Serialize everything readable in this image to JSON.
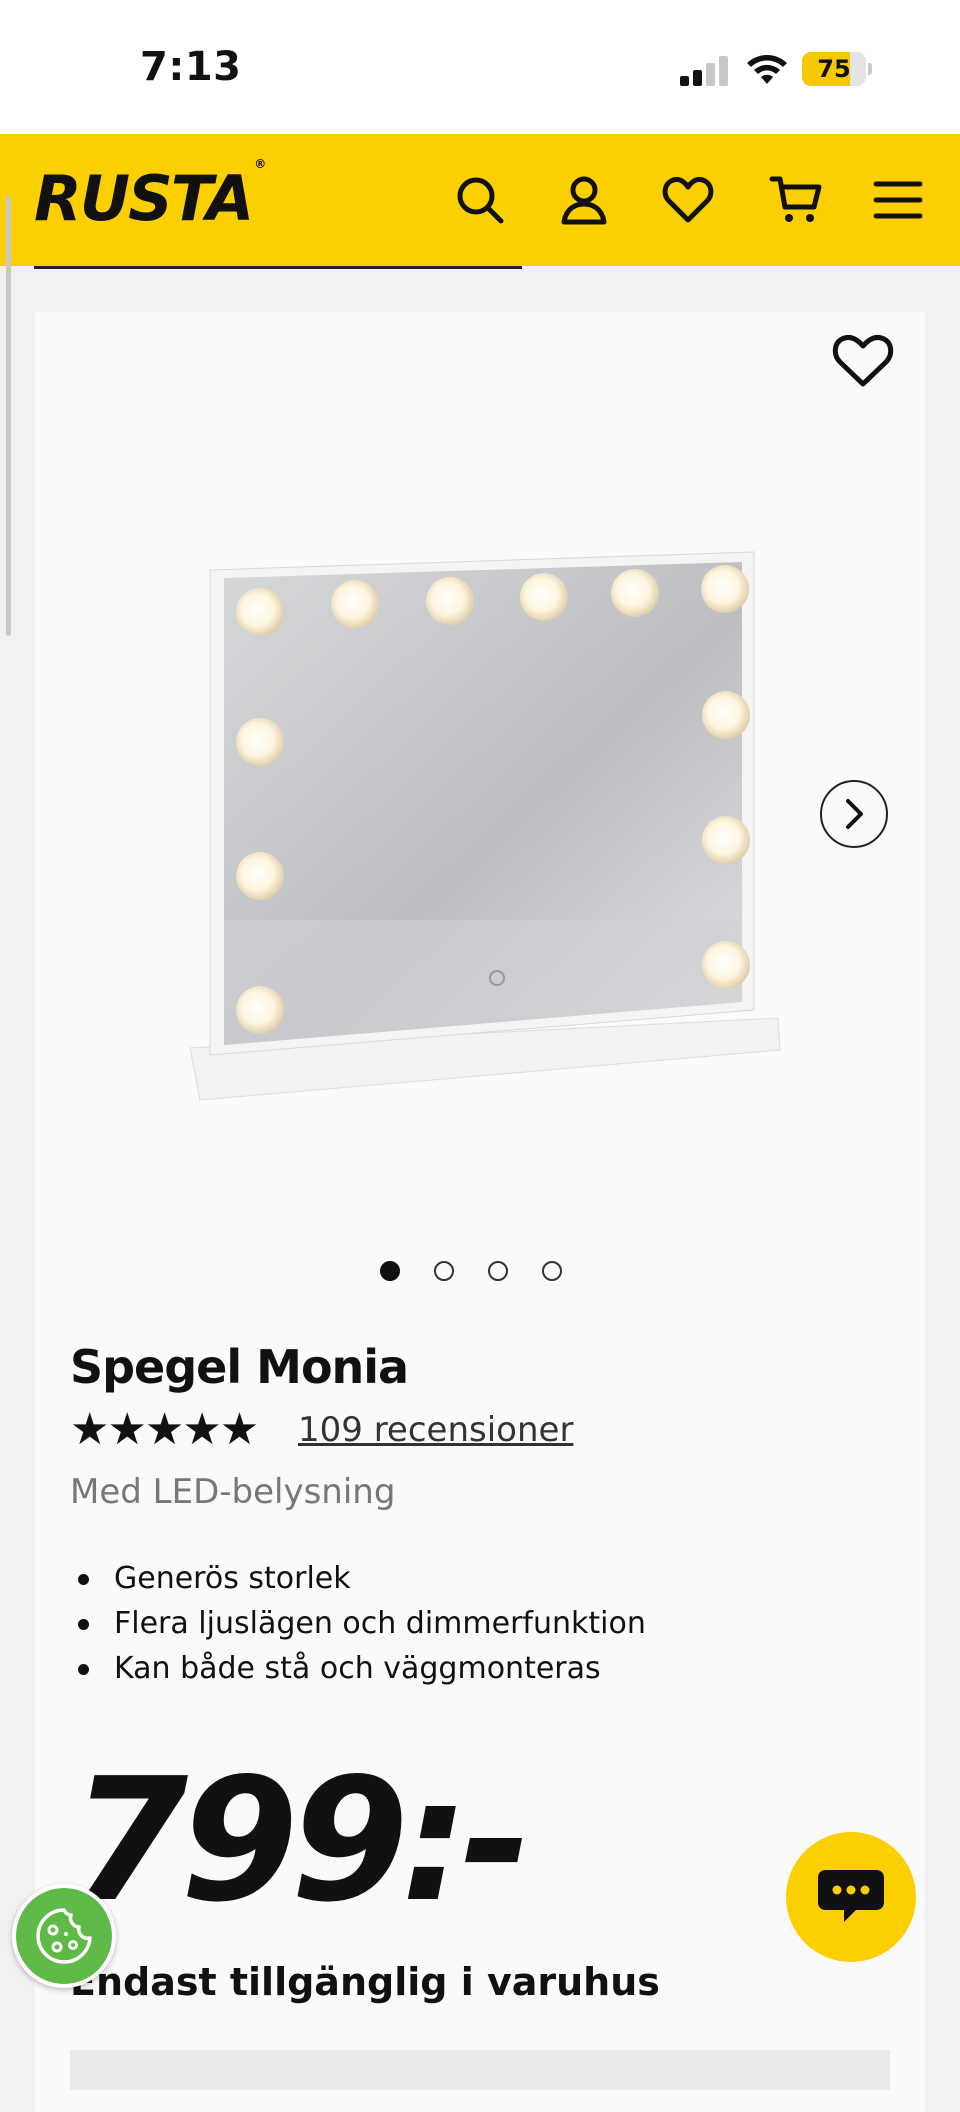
{
  "status_bar": {
    "time": "7:13",
    "battery": "75",
    "battery_level": 0.75
  },
  "header": {
    "logo": "RUSTA",
    "logo_mark": "®",
    "icons": [
      "search-icon",
      "account-icon",
      "heart-icon",
      "cart-icon",
      "menu-icon"
    ],
    "brand_color": "#fccf00"
  },
  "product": {
    "title": "Spegel Monia",
    "rating_stars": "★★★★★",
    "rating": 5,
    "reviews_link": "109 recensioner",
    "subtitle": "Med LED-belysning",
    "features": [
      "Generös storlek",
      "Flera ljuslägen och dimmerfunktion",
      "Kan både stå och väggmonteras"
    ],
    "price": "799:-",
    "availability": "Endast tillgänglig i varuhus",
    "image_count": 4,
    "active_image": 1
  },
  "colors": {
    "accent": "#fccf00",
    "cookie": "#5fba47",
    "text": "#111111"
  }
}
